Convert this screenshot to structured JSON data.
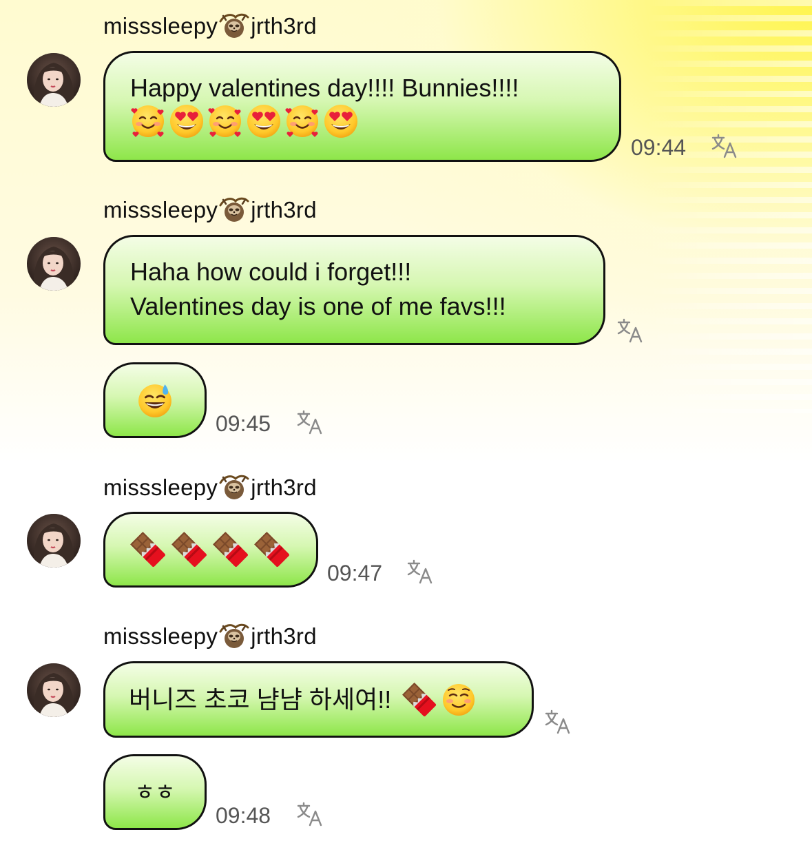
{
  "theme": {
    "bubble_border": "#111111",
    "bubble_top": "#f4fde6",
    "bubble_bottom": "#8ee64a",
    "background_accent": "#fff446",
    "time_color": "#555555"
  },
  "messages": [
    {
      "sender": {
        "name_left": "misssleepy",
        "name_emoji": "sloth-emoji",
        "name_right": "jrth3rd"
      },
      "bubbles": [
        {
          "lines": [
            "Happy valentines day!!!! Bunnies!!!!"
          ],
          "emojis": [
            "smiling-face-with-hearts",
            "heart-eyes",
            "smiling-face-with-hearts",
            "heart-eyes",
            "smiling-face-with-hearts",
            "heart-eyes"
          ],
          "time": "09:44",
          "translate_icon": "translate-icon"
        }
      ]
    },
    {
      "sender": {
        "name_left": "misssleepy",
        "name_emoji": "sloth-emoji",
        "name_right": "jrth3rd"
      },
      "bubbles": [
        {
          "lines": [
            "Haha how could i forget!!!",
            "Valentines day is one of me favs!!!"
          ],
          "time": "",
          "translate_icon": "translate-icon"
        },
        {
          "emojis": [
            "sweat-smile"
          ],
          "time": "09:45",
          "translate_icon": "translate-icon"
        }
      ]
    },
    {
      "sender": {
        "name_left": "misssleepy",
        "name_emoji": "sloth-emoji",
        "name_right": "jrth3rd"
      },
      "bubbles": [
        {
          "emojis": [
            "chocolate-bar",
            "chocolate-bar",
            "chocolate-bar",
            "chocolate-bar"
          ],
          "time": "09:47",
          "translate_icon": "translate-icon"
        }
      ]
    },
    {
      "sender": {
        "name_left": "misssleepy",
        "name_emoji": "sloth-emoji",
        "name_right": "jrth3rd"
      },
      "bubbles": [
        {
          "lines": [
            "버니즈 초코 냠냠 하세여!!"
          ],
          "emojis": [
            "chocolate-bar",
            "smiling-face"
          ],
          "time": "",
          "translate_icon": "translate-icon"
        },
        {
          "lines": [
            "ㅎㅎ"
          ],
          "time": "09:48",
          "translate_icon": "translate-icon"
        }
      ]
    }
  ]
}
